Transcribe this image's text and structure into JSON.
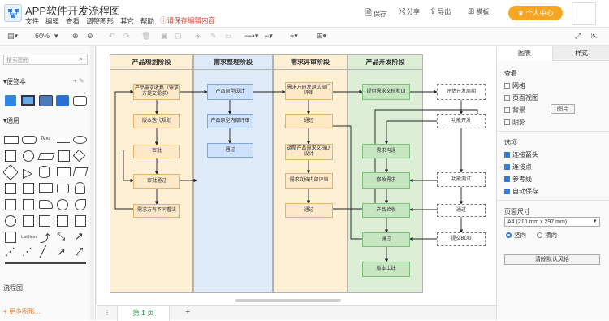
{
  "app": {
    "title": "APP软件开发流程图",
    "unsaved": "请保存编辑内容"
  },
  "menu": [
    "文件",
    "编辑",
    "查看",
    "调整图形",
    "其它",
    "帮助"
  ],
  "topbar": {
    "save": "保存",
    "share": "分享",
    "export": "导出",
    "template": "模板",
    "vip": "个人中心"
  },
  "toolbar": {
    "zoom": "60%"
  },
  "left": {
    "search_placeholder": "搜索图形",
    "sec_notes": "便签本",
    "sec_general": "通用",
    "sec_flow": "流程图",
    "sec_more": "+ 更多图形...",
    "text_label": "Text",
    "list_label": "List Item"
  },
  "columns": [
    {
      "title": "产品规划阶段",
      "color": "#fdf0d5"
    },
    {
      "title": "需求整理阶段",
      "color": "#dfeaf8"
    },
    {
      "title": "需求评审阶段",
      "color": "#fdf0d5"
    },
    {
      "title": "产品开发阶段",
      "color": "#dcefd6"
    }
  ],
  "nodes": {
    "a1": "产品需求收集（需求方提交需求）",
    "a2": "版本迭代规划",
    "a3": "审批",
    "a4": "审批通过",
    "a5": "需求方有不同看法",
    "b1": "产品原型设计",
    "b2": "产品原型内部评审",
    "b3": "通过",
    "c1": "需求方研发测试部门评审",
    "c2": "通过",
    "c3": "调整产品需求文档UI设计",
    "c4": "需求文档内部评审",
    "c5": "通过",
    "d1": "提供需求文档和UI",
    "d2": "需求沟通",
    "d3": "修改需求",
    "d4": "产品验收",
    "d5": "通过",
    "d6": "版本上线",
    "e1": "评估开发周期",
    "e2": "功能开发",
    "e3": "功能测试",
    "e4": "通过",
    "e5": "提交BUG"
  },
  "right": {
    "tab_chart": "图表",
    "tab_style": "样式",
    "view_title": "查看",
    "grid": "网格",
    "pageview": "页面视图",
    "background": "背景",
    "image_btn": "图片",
    "shadow": "阴影",
    "opt_title": "选项",
    "conn_arrow": "连接箭头",
    "conn_point": "连接点",
    "guides": "参考线",
    "autosave": "自动保存",
    "page_size": "页面尺寸",
    "paper": "A4 (210 mm x 297 mm)",
    "portrait": "竖向",
    "landscape": "横向",
    "reset": "清除默认风格"
  },
  "pagebar": {
    "page": "第 1 页"
  }
}
